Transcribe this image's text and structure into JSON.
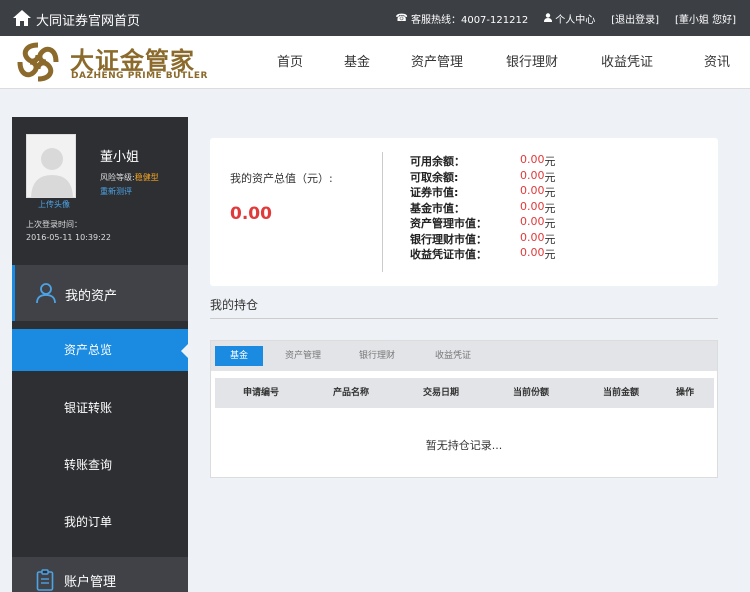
{
  "topbar": {
    "site_link": "大同证券官网首页",
    "hotline": "客服热线：4007-121212",
    "personal_center": "个人中心",
    "logout": "[退出登录]",
    "greeting": "[董小姐 您好]"
  },
  "header": {
    "brand_cn": "大证金管家",
    "brand_en": "DAZHENG PRIME BUTLER",
    "brand_color": "#8b6a2c",
    "nav": [
      "首页",
      "基金",
      "资产管理",
      "银行理财",
      "收益凭证",
      "资讯"
    ]
  },
  "sidebar": {
    "upload_avatar": "上传头像",
    "user_name": "董小姐",
    "risk_label": "风险等级:",
    "risk_level": "稳健型",
    "retest": "重新测评",
    "last_login_label": "上次登录时间：",
    "last_login_time": "2016-05-11 10:39:22",
    "menu_assets": "我的资产",
    "items": [
      "资产总览",
      "银证转账",
      "转账查询",
      "我的订单"
    ],
    "menu_account": "账户管理"
  },
  "assets": {
    "total_label": "我的资产总值（元）:",
    "total_value": "0.00",
    "rows": [
      {
        "label": "可用余额：",
        "value": "0.00",
        "unit": "元"
      },
      {
        "label": "可取余额:",
        "value": "0.00",
        "unit": "元"
      },
      {
        "label": "证券市值:",
        "value": "0.00",
        "unit": "元"
      },
      {
        "label": "基金市值：",
        "value": "0.00",
        "unit": "元"
      },
      {
        "label": "资产管理市值：",
        "value": "0.00",
        "unit": "元"
      },
      {
        "label": "银行理财市值：",
        "value": "0.00",
        "unit": "元"
      },
      {
        "label": "收益凭证市值：",
        "value": "0.00",
        "unit": "元"
      }
    ]
  },
  "holdings": {
    "title": "我的持仓",
    "tabs": [
      "基金",
      "资产管理",
      "银行理财",
      "收益凭证"
    ],
    "columns": [
      "申请编号",
      "产品名称",
      "交易日期",
      "当前份额",
      "当前金额",
      "操作"
    ],
    "empty_text": "暂无持仓记录..."
  },
  "colors": {
    "accent": "#1a8be0",
    "value_red": "#e03a3a",
    "topbar_bg": "#3c3f44",
    "sidebar_bg": "#2d2f33"
  }
}
